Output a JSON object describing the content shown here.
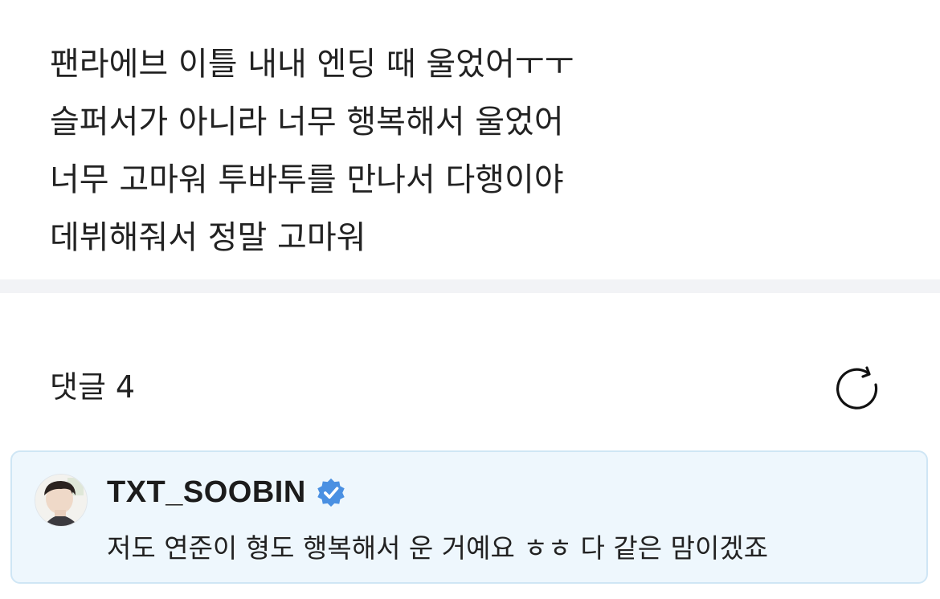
{
  "post": {
    "lines": [
      "팬라에브 이틀 내내 엔딩 때 울었어ㅜㅜ",
      "슬퍼서가 아니라 너무 행복해서 울었어",
      "너무 고마워 투바투를 만나서 다행이야",
      "데뷔해줘서 정말 고마워"
    ]
  },
  "comments": {
    "title": "댓글",
    "count": "4",
    "refresh_icon": "refresh-icon",
    "items": [
      {
        "author": "TXT_SOOBIN",
        "verified": true,
        "verified_color": "#4a90e2",
        "text": "저도 연준이 형도 행복해서 운 거예요 ㅎㅎ 다 같은 맘이겠죠",
        "avatar_icon": "avatar"
      }
    ]
  },
  "colors": {
    "highlight_background": "#eef7fd",
    "highlight_border": "#cfe6f5",
    "divider": "#f2f3f6",
    "text": "#222222"
  }
}
